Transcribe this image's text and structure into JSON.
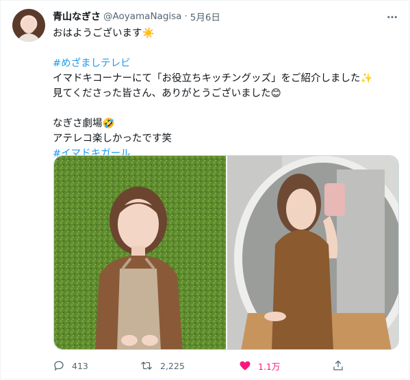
{
  "tweet": {
    "author_name": "青山なぎさ",
    "author_handle": "@AoyamaNagisa",
    "separator": "·",
    "date": "5月6日",
    "lines": [
      "おはようございます☀️",
      "",
      "#めざましテレビ",
      "イマドキコーナーにて「お役立ちキッチングッズ」をご紹介しました✨",
      "見てくださった皆さん、ありがとうございました😊",
      "",
      "なぎさ劇場🤣",
      "アテレコ楽しかったです笑",
      "#イマドキガール"
    ]
  },
  "actions": {
    "reply_count": "413",
    "retweet_count": "2,225",
    "like_count": "1.1万",
    "like_active": true
  },
  "colors": {
    "hashtag": "#1d9bf0",
    "like": "#f91880",
    "secondary_text": "#536471"
  },
  "icons": [
    "more-icon",
    "reply-icon",
    "retweet-icon",
    "like-icon",
    "share-icon"
  ]
}
